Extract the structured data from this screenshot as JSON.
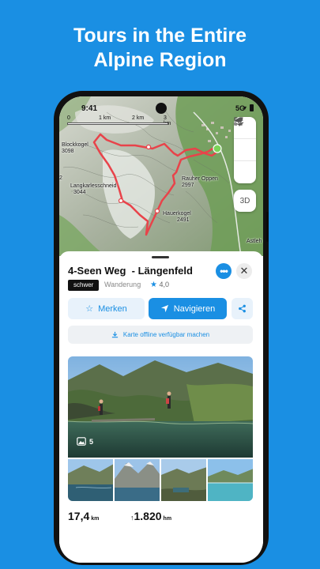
{
  "headline": {
    "line1": "Tours in the Entire",
    "line2": "Alpine Region"
  },
  "status_bar": {
    "time": "9:41",
    "network": "5G"
  },
  "map": {
    "scale": [
      "0",
      "1 km",
      "2 km",
      "3 km"
    ],
    "labels": {
      "blockkogel": "Blockkogel",
      "blockkogel_alt": "3098",
      "left_cut": "2",
      "langkarlesschneid": "Langkarlesschneid",
      "langkarlesschneid_alt": "3044",
      "rauher_oppen": "Rauher Oppen",
      "rauher_oppen_alt": "2997",
      "hauerkogel": "Hauerkogel",
      "hauerkogel_alt": "2491",
      "astlehn": "Astleh"
    },
    "controls": {
      "threed_label": "3D"
    },
    "route_color": "#e8434a"
  },
  "tour": {
    "title": "4-Seen Weg  - Längenfeld",
    "difficulty": "schwer",
    "category": "Wanderung",
    "rating": "4,0"
  },
  "actions": {
    "save_label": "Merken",
    "navigate_label": "Navigieren",
    "offline_label": "Karte offline verfügbar machen"
  },
  "gallery": {
    "count": "5"
  },
  "stats": {
    "distance_value": "17,4",
    "distance_unit": "km",
    "ascent_value": "1.820",
    "ascent_unit": "hm",
    "ascent_icon": "↑"
  },
  "colors": {
    "brand": "#1a8fe3",
    "background": "#1a8fe3",
    "badge": "#111111"
  }
}
